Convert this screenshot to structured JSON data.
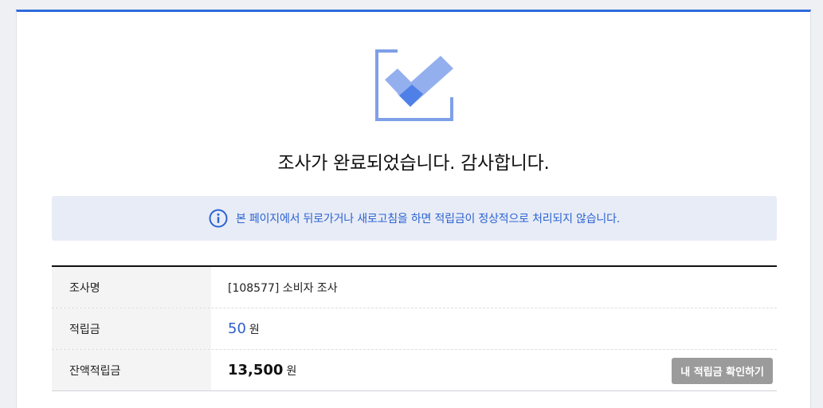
{
  "completion": {
    "title": "조사가 완료되었습니다. 감사합니다.",
    "icon": "checkbox-check-icon",
    "icon_colors": {
      "frame": "#7fa0e8",
      "check_light": "#93afee",
      "check_dark": "#4f80e8"
    }
  },
  "notice": {
    "icon": "info-circle-icon",
    "text": "본 페이지에서 뒤로가거나 새로고침을 하면 적립금이 정상적으로 처리되지 않습니다.",
    "color": "#2b63d2"
  },
  "summary": {
    "survey_name_label": "조사명",
    "survey_name_value": "[108577] 소비자 조사",
    "points_label": "적립금",
    "points_value": "50",
    "points_unit": "원",
    "balance_label": "잔액적립금",
    "balance_value": "13,500",
    "balance_unit": "원",
    "my_points_button": "내 적립금 확인하기"
  },
  "colors": {
    "accent": "#2f6bdc",
    "button_bg": "#9b9b9b"
  }
}
